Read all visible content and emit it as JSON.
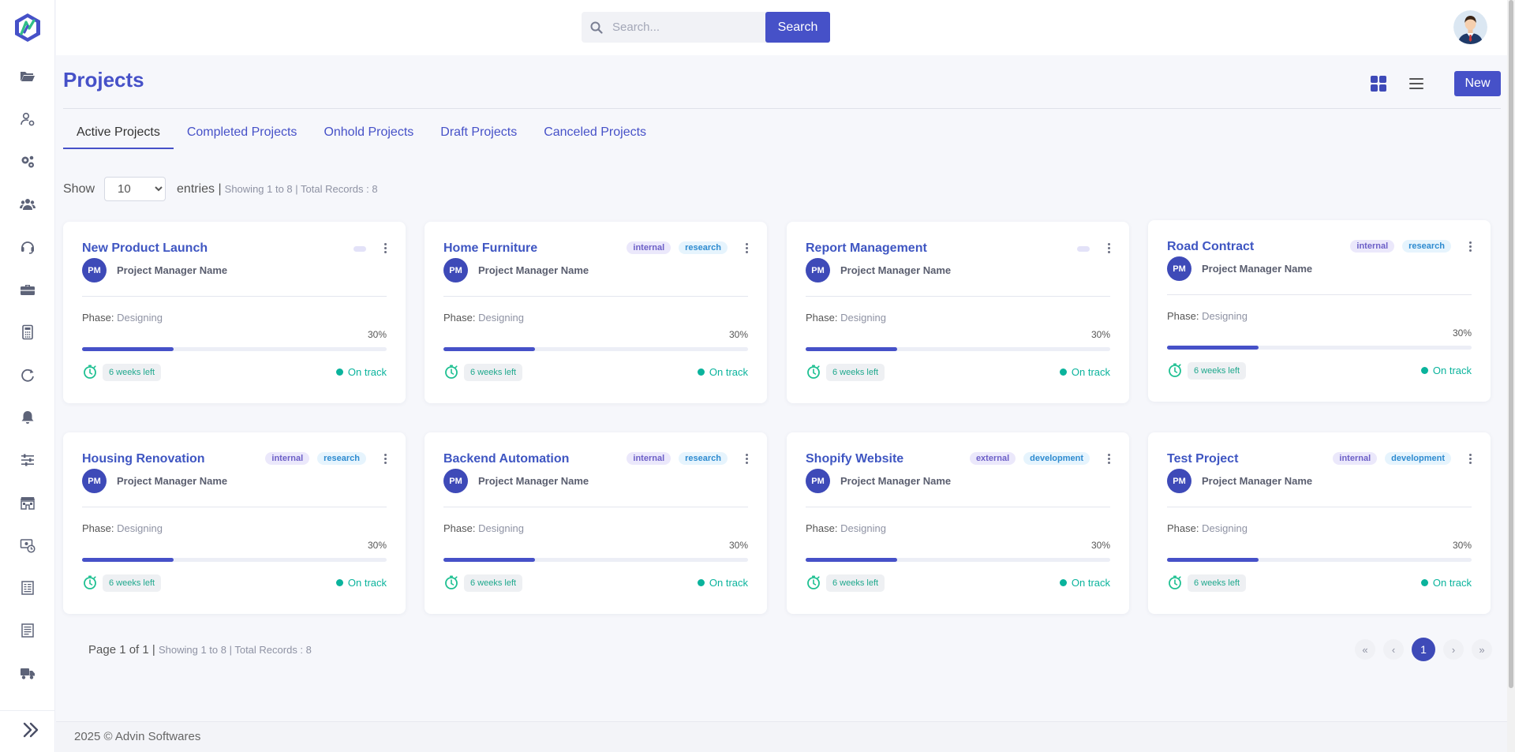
{
  "brand": {
    "logo_icon": "advin-logo-icon",
    "accent": "#4651c8"
  },
  "search": {
    "placeholder": "Search...",
    "button_label": "Search"
  },
  "page": {
    "title": "Projects",
    "new_label": "New"
  },
  "tabs": [
    "Active Projects",
    "Completed Projects",
    "Onhold Projects",
    "Draft Projects",
    "Canceled Projects"
  ],
  "entries": {
    "show_label": "Show",
    "value": "10",
    "entries_label": "entries |",
    "summary": "Showing 1 to 8 | Total Records : 8"
  },
  "cards": [
    {
      "title": "New Product Launch",
      "tags": [],
      "pm_initials": "PM",
      "pm_name": "Project Manager Name",
      "phase_label": "Phase:",
      "phase": "Designing",
      "progress": "30%",
      "progress_value": 0.3,
      "time_left": "6 weeks left",
      "status": "On track"
    },
    {
      "title": "Home Furniture",
      "tags": [
        "internal",
        "research"
      ],
      "pm_initials": "PM",
      "pm_name": "Project Manager Name",
      "phase_label": "Phase:",
      "phase": "Designing",
      "progress": "30%",
      "progress_value": 0.3,
      "time_left": "6 weeks left",
      "status": "On track"
    },
    {
      "title": "Report Management",
      "tags": [],
      "pm_initials": "PM",
      "pm_name": "Project Manager Name",
      "phase_label": "Phase:",
      "phase": "Designing",
      "progress": "30%",
      "progress_value": 0.3,
      "time_left": "6 weeks left",
      "status": "On track"
    },
    {
      "title": "Road Contract",
      "tags": [
        "internal",
        "research"
      ],
      "pm_initials": "PM",
      "pm_name": "Project Manager Name",
      "phase_label": "Phase:",
      "phase": "Designing",
      "progress": "30%",
      "progress_value": 0.3,
      "time_left": "6 weeks left",
      "status": "On track"
    },
    {
      "title": "Housing Renovation",
      "tags": [
        "internal",
        "research"
      ],
      "pm_initials": "PM",
      "pm_name": "Project Manager Name",
      "phase_label": "Phase:",
      "phase": "Designing",
      "progress": "30%",
      "progress_value": 0.3,
      "time_left": "6 weeks left",
      "status": "On track"
    },
    {
      "title": "Backend Automation",
      "tags": [
        "internal",
        "research"
      ],
      "pm_initials": "PM",
      "pm_name": "Project Manager Name",
      "phase_label": "Phase:",
      "phase": "Designing",
      "progress": "30%",
      "progress_value": 0.3,
      "time_left": "6 weeks left",
      "status": "On track"
    },
    {
      "title": "Shopify Website",
      "tags": [
        "external",
        "development"
      ],
      "pm_initials": "PM",
      "pm_name": "Project Manager Name",
      "phase_label": "Phase:",
      "phase": "Designing",
      "progress": "30%",
      "progress_value": 0.3,
      "time_left": "6 weeks left",
      "status": "On track"
    },
    {
      "title": "Test Project",
      "tags": [
        "internal",
        "development"
      ],
      "pm_initials": "PM",
      "pm_name": "Project Manager Name",
      "phase_label": "Phase:",
      "phase": "Designing",
      "progress": "30%",
      "progress_value": 0.3,
      "time_left": "6 weeks left",
      "status": "On track"
    }
  ],
  "pagination": {
    "page_text": "Page 1 of 1 |",
    "summary": "Showing 1 to 8 | Total Records : 8",
    "first": "«",
    "prev": "‹",
    "current": "1",
    "next": "›",
    "last": "»"
  },
  "footer": {
    "text": "2025 © Advin Softwares"
  },
  "sidebar_icons": [
    "folder-icon",
    "user-settings-icon",
    "gears-icon",
    "users-icon",
    "headset-icon",
    "briefcase-icon",
    "calculator-icon",
    "refresh-icon",
    "bell-icon",
    "sliders-icon",
    "store-icon",
    "money-clock-icon",
    "receipt-icon",
    "document-icon",
    "truck-icon"
  ],
  "status_color": "#0ab39c"
}
